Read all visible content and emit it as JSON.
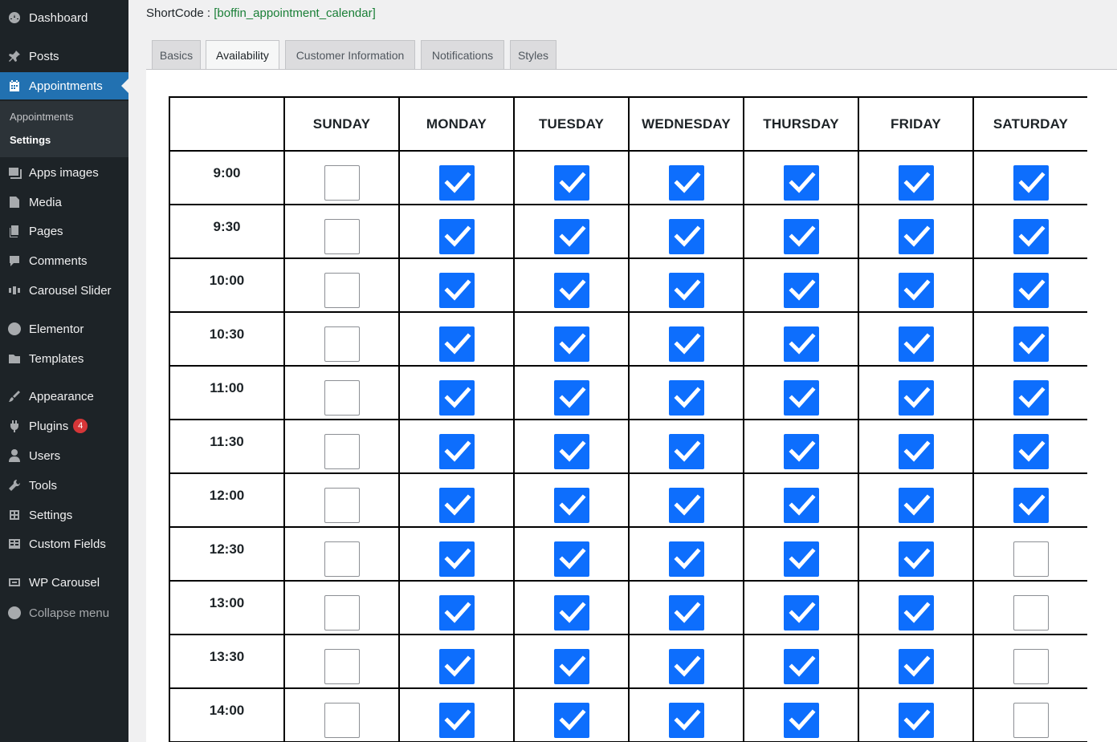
{
  "sidebar": {
    "items": [
      {
        "label": "Dashboard",
        "icon": "dashboard-icon"
      },
      {
        "label": "Posts",
        "icon": "pin-icon"
      },
      {
        "label": "Appointments",
        "icon": "calendar-icon"
      },
      {
        "label": "Apps images",
        "icon": "images-icon"
      },
      {
        "label": "Media",
        "icon": "media-icon"
      },
      {
        "label": "Pages",
        "icon": "pages-icon"
      },
      {
        "label": "Comments",
        "icon": "comment-icon"
      },
      {
        "label": "Carousel Slider",
        "icon": "slider-icon"
      },
      {
        "label": "Elementor",
        "icon": "elementor-icon"
      },
      {
        "label": "Templates",
        "icon": "folder-icon"
      },
      {
        "label": "Appearance",
        "icon": "brush-icon"
      },
      {
        "label": "Plugins",
        "icon": "plug-icon",
        "badge": "4"
      },
      {
        "label": "Users",
        "icon": "user-icon"
      },
      {
        "label": "Tools",
        "icon": "wrench-icon"
      },
      {
        "label": "Settings",
        "icon": "settings-icon"
      },
      {
        "label": "Custom Fields",
        "icon": "table-icon"
      },
      {
        "label": "WP Carousel",
        "icon": "carousel-icon"
      },
      {
        "label": "Collapse menu",
        "icon": "collapse-icon"
      }
    ],
    "submenu": [
      "Appointments",
      "Settings"
    ]
  },
  "shortcode": {
    "label": "ShortCode :",
    "value": "[boffin_appointment_calendar]"
  },
  "tabs": [
    "Basics",
    "Availability",
    "Customer Information",
    "Notifications",
    "Styles"
  ],
  "active_tab": "Availability",
  "days": [
    "SUNDAY",
    "MONDAY",
    "TUESDAY",
    "WEDNESDAY",
    "THURSDAY",
    "FRIDAY",
    "SATURDAY"
  ],
  "slots": [
    {
      "time": "9:00",
      "checked": [
        false,
        true,
        true,
        true,
        true,
        true,
        true
      ]
    },
    {
      "time": "9:30",
      "checked": [
        false,
        true,
        true,
        true,
        true,
        true,
        true
      ]
    },
    {
      "time": "10:00",
      "checked": [
        false,
        true,
        true,
        true,
        true,
        true,
        true
      ]
    },
    {
      "time": "10:30",
      "checked": [
        false,
        true,
        true,
        true,
        true,
        true,
        true
      ]
    },
    {
      "time": "11:00",
      "checked": [
        false,
        true,
        true,
        true,
        true,
        true,
        true
      ]
    },
    {
      "time": "11:30",
      "checked": [
        false,
        true,
        true,
        true,
        true,
        true,
        true
      ]
    },
    {
      "time": "12:00",
      "checked": [
        false,
        true,
        true,
        true,
        true,
        true,
        true
      ]
    },
    {
      "time": "12:30",
      "checked": [
        false,
        true,
        true,
        true,
        true,
        true,
        false
      ]
    },
    {
      "time": "13:00",
      "checked": [
        false,
        true,
        true,
        true,
        true,
        true,
        false
      ]
    },
    {
      "time": "13:30",
      "checked": [
        false,
        true,
        true,
        true,
        true,
        true,
        false
      ]
    },
    {
      "time": "14:00",
      "checked": [
        false,
        true,
        true,
        true,
        true,
        true,
        false
      ]
    }
  ],
  "colors": {
    "accent": "#2271b1",
    "checkbox": "#0d6efd",
    "sidebar": "#1d2327",
    "badge": "#d63638"
  }
}
